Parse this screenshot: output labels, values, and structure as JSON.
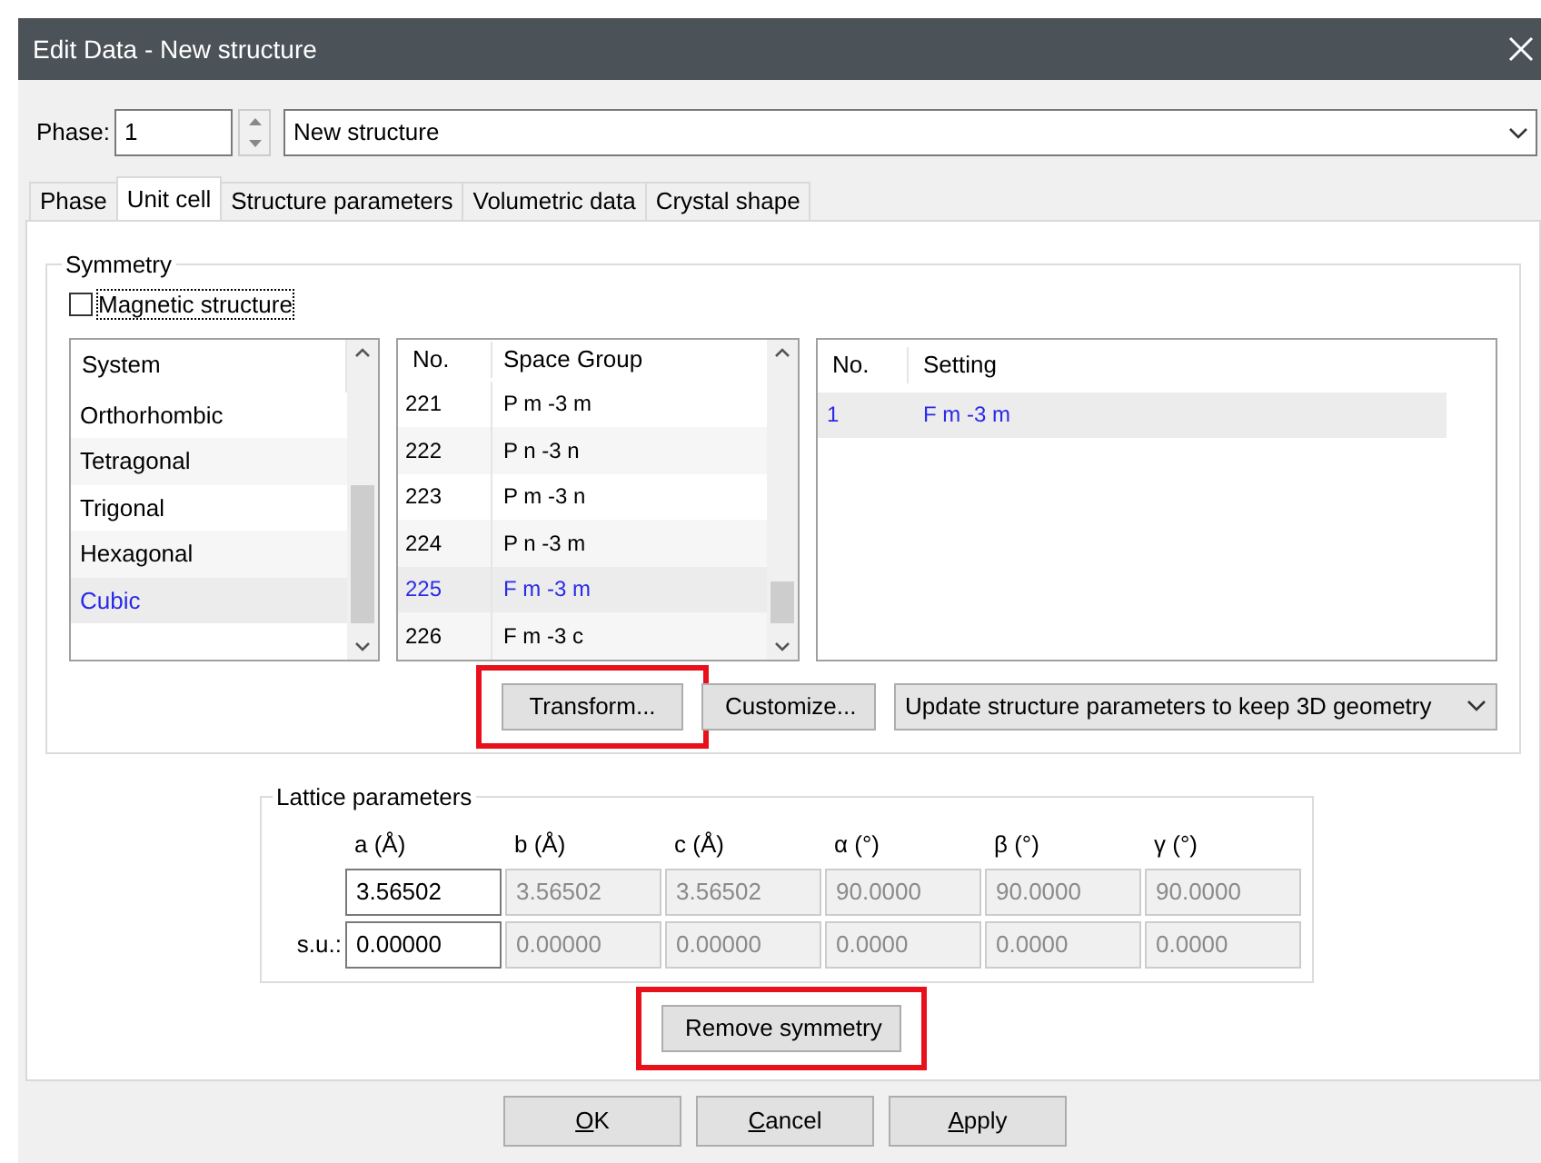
{
  "window": {
    "title": "Edit Data - New structure"
  },
  "phase": {
    "label": "Phase:",
    "number": "1",
    "name": "New structure"
  },
  "tabs": [
    {
      "label": "Phase",
      "selected": false
    },
    {
      "label": "Unit cell",
      "selected": true
    },
    {
      "label": "Structure parameters",
      "selected": false
    },
    {
      "label": "Volumetric data",
      "selected": false
    },
    {
      "label": "Crystal shape",
      "selected": false
    }
  ],
  "symmetry": {
    "title": "Symmetry",
    "magnetic": {
      "label": "Magnetic structure",
      "checked": false
    },
    "systems": {
      "header": "System",
      "items": [
        {
          "label": "Orthorhombic",
          "selected": false
        },
        {
          "label": "Tetragonal",
          "selected": false
        },
        {
          "label": "Trigonal",
          "selected": false
        },
        {
          "label": "Hexagonal",
          "selected": false
        },
        {
          "label": "Cubic",
          "selected": true
        }
      ]
    },
    "space_groups": {
      "columns": [
        "No.",
        "Space Group"
      ],
      "rows": [
        {
          "no": "221",
          "symbol": "P m -3 m",
          "selected": false
        },
        {
          "no": "222",
          "symbol": "P n -3 n",
          "selected": false
        },
        {
          "no": "223",
          "symbol": "P m -3 n",
          "selected": false
        },
        {
          "no": "224",
          "symbol": "P n -3 m",
          "selected": false
        },
        {
          "no": "225",
          "symbol": "F m -3 m",
          "selected": true
        },
        {
          "no": "226",
          "symbol": "F m -3 c",
          "selected": false
        }
      ]
    },
    "settings": {
      "columns": [
        "No.",
        "Setting"
      ],
      "rows": [
        {
          "no": "1",
          "symbol": "F m -3 m",
          "selected": true
        }
      ]
    },
    "buttons": [
      {
        "label": "Transform...",
        "highlighted": true
      },
      {
        "label": "Customize...",
        "highlighted": false
      }
    ],
    "update_mode": "Update structure parameters to keep 3D geometry"
  },
  "lattice": {
    "title": "Lattice parameters",
    "columns": [
      "a (Å)",
      "b (Å)",
      "c (Å)",
      "α (°)",
      "β (°)",
      "γ (°)"
    ],
    "rows": [
      {
        "values": [
          {
            "value": "3.56502",
            "disabled": false
          },
          {
            "value": "3.56502",
            "disabled": true
          },
          {
            "value": "3.56502",
            "disabled": true
          },
          {
            "value": "90.0000",
            "disabled": true
          },
          {
            "value": "90.0000",
            "disabled": true
          },
          {
            "value": "90.0000",
            "disabled": true
          }
        ]
      },
      {
        "label": "s.u.:",
        "values": [
          {
            "value": "0.00000",
            "disabled": false
          },
          {
            "value": "0.00000",
            "disabled": true
          },
          {
            "value": "0.00000",
            "disabled": true
          },
          {
            "value": "0.0000",
            "disabled": true
          },
          {
            "value": "0.0000",
            "disabled": true
          },
          {
            "value": "0.0000",
            "disabled": true
          }
        ]
      }
    ]
  },
  "remove_button": {
    "label": "Remove symmetry",
    "highlighted": true
  },
  "footer_buttons": [
    {
      "label": "OK",
      "underline_first": true
    },
    {
      "label": "Cancel",
      "underline_first": true
    },
    {
      "label": "Apply",
      "underline_first": true
    }
  ]
}
